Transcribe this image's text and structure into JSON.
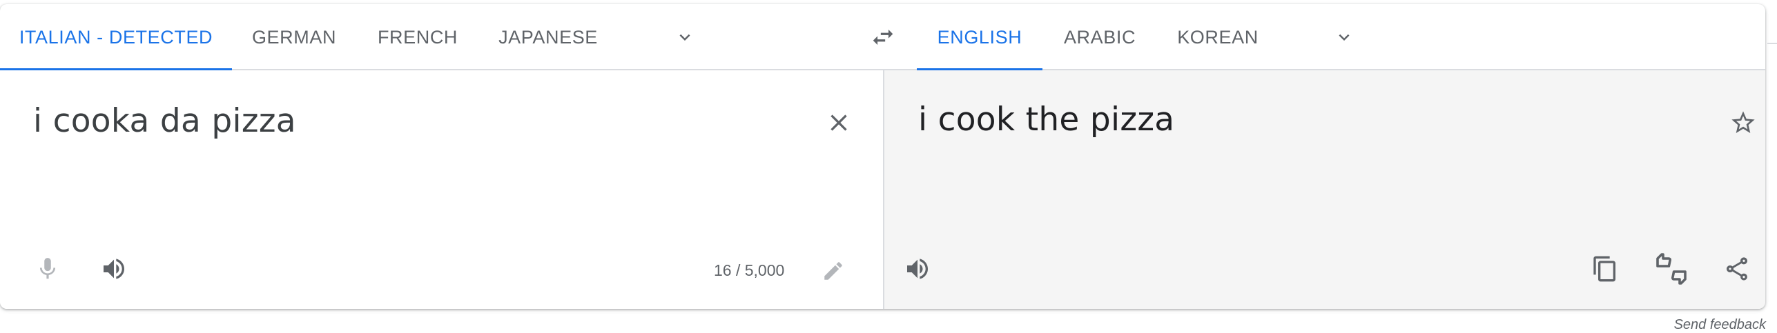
{
  "source_tabs": [
    {
      "label": "ITALIAN - DETECTED",
      "active": true
    },
    {
      "label": "GERMAN",
      "active": false
    },
    {
      "label": "FRENCH",
      "active": false
    },
    {
      "label": "JAPANESE",
      "active": false
    }
  ],
  "target_tabs": [
    {
      "label": "ENGLISH",
      "active": true
    },
    {
      "label": "ARABIC",
      "active": false
    },
    {
      "label": "KOREAN",
      "active": false
    }
  ],
  "source": {
    "text": "i cooka da pizza",
    "char_count": "16 / 5,000"
  },
  "target": {
    "text": "i cook the pizza"
  },
  "footer": {
    "feedback_label": "Send feedback"
  },
  "icons": {
    "source_more": "chevron-down-icon",
    "swap": "swap-languages-icon",
    "target_more": "chevron-down-icon",
    "clear": "close-icon",
    "mic": "microphone-icon",
    "listen_source": "volume-icon",
    "edit": "pencil-icon",
    "star": "star-icon",
    "listen_target": "volume-icon",
    "copy": "copy-icon",
    "rate": "thumbs-up-down-icon",
    "share": "share-icon"
  },
  "colors": {
    "accent": "#1a73e8",
    "tab_text": "#5f6368",
    "icon": "#5f6368",
    "icon_disabled": "#9aa0a6",
    "output_bg": "#f5f5f5"
  }
}
